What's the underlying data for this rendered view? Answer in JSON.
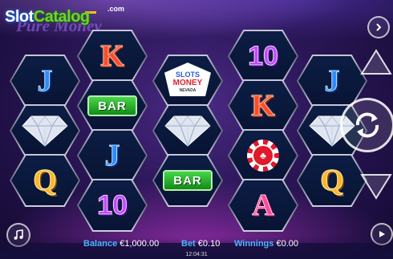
{
  "logo": {
    "site_text_a": "Slot",
    "site_text_b": "Catalog",
    "site_suffix": ".com",
    "game_script_text": "Pure Money"
  },
  "reels": {
    "symbols": [
      {
        "kind": "letter",
        "value": "J"
      },
      {
        "kind": "diamond",
        "value": "diamond"
      },
      {
        "kind": "letter",
        "value": "Q"
      },
      {
        "kind": "letter",
        "value": "K"
      },
      {
        "kind": "bar",
        "value": "BAR"
      },
      {
        "kind": "letter",
        "value": "J"
      },
      {
        "kind": "letter",
        "value": "10"
      },
      {
        "kind": "sign",
        "value": "SLOTS MONEY NEVADA",
        "line1": "SLOTS",
        "line2": "MONEY",
        "line3": "NEVADA"
      },
      {
        "kind": "diamond",
        "value": "diamond"
      },
      {
        "kind": "bar",
        "value": "BAR"
      },
      {
        "kind": "letter",
        "value": "10"
      },
      {
        "kind": "letter",
        "value": "K"
      },
      {
        "kind": "chip",
        "value": "poker-chip"
      },
      {
        "kind": "letter",
        "value": "A"
      },
      {
        "kind": "letter",
        "value": "J"
      },
      {
        "kind": "diamond",
        "value": "diamond"
      },
      {
        "kind": "letter",
        "value": "Q"
      }
    ]
  },
  "controls": {
    "menu_icon": "chevron-right-circle-icon",
    "up_icon": "triangle-up-icon",
    "spin_icon": "spin-arrows-icon",
    "down_icon": "triangle-down-icon",
    "sound_icon": "music-note-icon",
    "autoplay_icon": "play-icon"
  },
  "status": {
    "balance_label": "Balance",
    "balance_value": "€1,000.00",
    "bet_label": "Bet",
    "bet_value": "€0.10",
    "winnings_label": "Winnings",
    "winnings_value": "€0.00",
    "clock": "12:04:31"
  },
  "colors": {
    "accent_blue": "#49b6ff",
    "bar_green": "#2fb534",
    "background_purple": "#2a1656"
  }
}
